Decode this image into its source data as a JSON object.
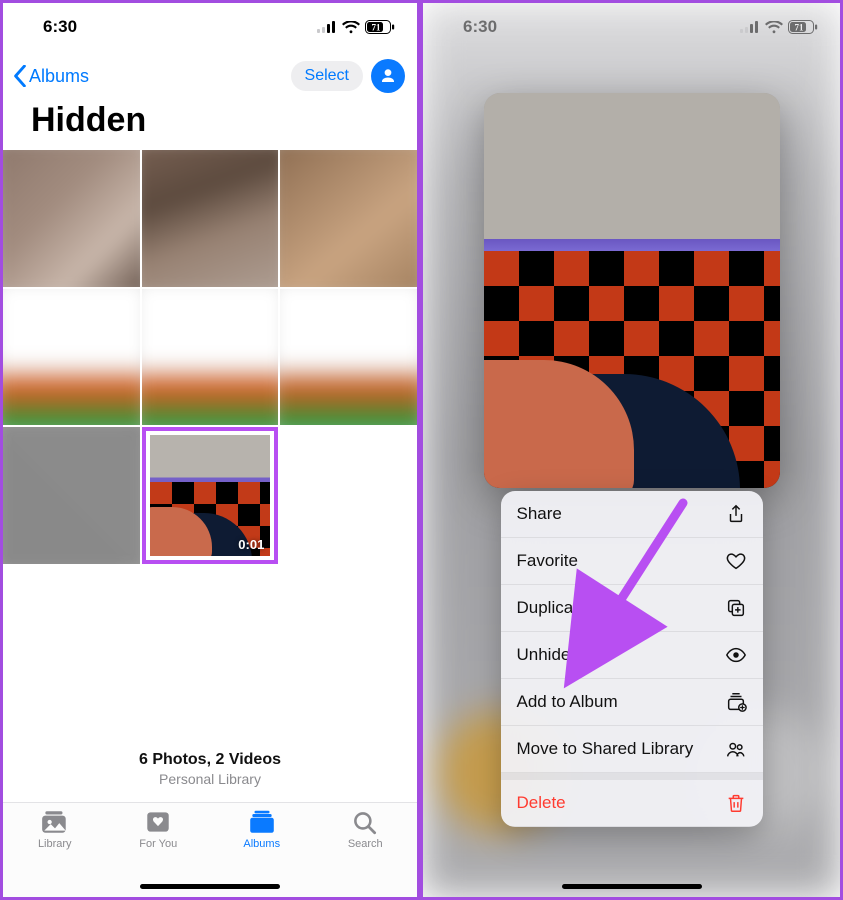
{
  "status": {
    "time": "6:30",
    "battery": "71"
  },
  "left": {
    "back_label": "Albums",
    "select_label": "Select",
    "title": "Hidden",
    "video_duration": "0:01",
    "summary_line1": "6 Photos, 2 Videos",
    "summary_line2": "Personal Library",
    "tabs": {
      "library": "Library",
      "for_you": "For You",
      "albums": "Albums",
      "search": "Search"
    }
  },
  "right": {
    "menu": {
      "share": "Share",
      "favorite": "Favorite",
      "duplicate": "Duplicate",
      "unhide": "Unhide",
      "add_to_album": "Add to Album",
      "move_shared": "Move to Shared Library",
      "delete": "Delete"
    }
  }
}
